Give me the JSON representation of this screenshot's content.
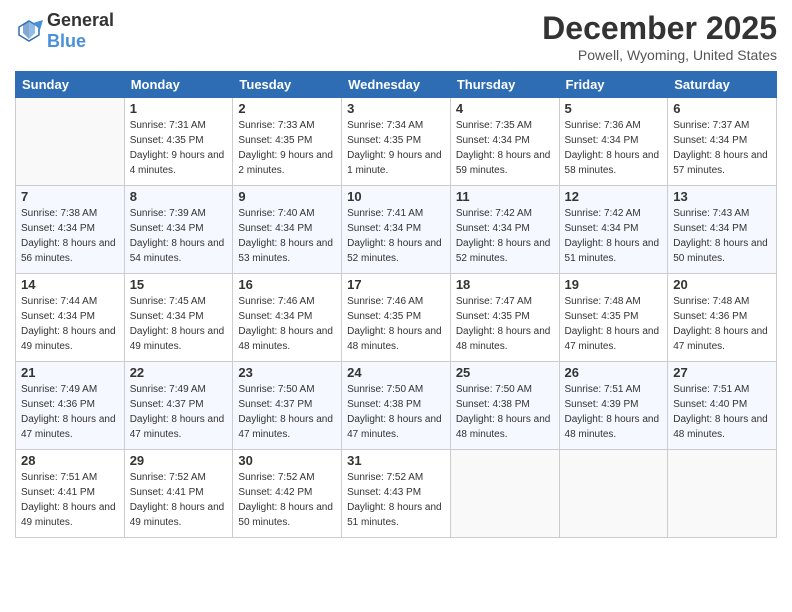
{
  "logo": {
    "text_general": "General",
    "text_blue": "Blue"
  },
  "header": {
    "month": "December 2025",
    "location": "Powell, Wyoming, United States"
  },
  "days_of_week": [
    "Sunday",
    "Monday",
    "Tuesday",
    "Wednesday",
    "Thursday",
    "Friday",
    "Saturday"
  ],
  "weeks": [
    [
      {
        "day": "",
        "sunrise": "",
        "sunset": "",
        "daylight": ""
      },
      {
        "day": "1",
        "sunrise": "Sunrise: 7:31 AM",
        "sunset": "Sunset: 4:35 PM",
        "daylight": "Daylight: 9 hours and 4 minutes."
      },
      {
        "day": "2",
        "sunrise": "Sunrise: 7:33 AM",
        "sunset": "Sunset: 4:35 PM",
        "daylight": "Daylight: 9 hours and 2 minutes."
      },
      {
        "day": "3",
        "sunrise": "Sunrise: 7:34 AM",
        "sunset": "Sunset: 4:35 PM",
        "daylight": "Daylight: 9 hours and 1 minute."
      },
      {
        "day": "4",
        "sunrise": "Sunrise: 7:35 AM",
        "sunset": "Sunset: 4:34 PM",
        "daylight": "Daylight: 8 hours and 59 minutes."
      },
      {
        "day": "5",
        "sunrise": "Sunrise: 7:36 AM",
        "sunset": "Sunset: 4:34 PM",
        "daylight": "Daylight: 8 hours and 58 minutes."
      },
      {
        "day": "6",
        "sunrise": "Sunrise: 7:37 AM",
        "sunset": "Sunset: 4:34 PM",
        "daylight": "Daylight: 8 hours and 57 minutes."
      }
    ],
    [
      {
        "day": "7",
        "sunrise": "Sunrise: 7:38 AM",
        "sunset": "Sunset: 4:34 PM",
        "daylight": "Daylight: 8 hours and 56 minutes."
      },
      {
        "day": "8",
        "sunrise": "Sunrise: 7:39 AM",
        "sunset": "Sunset: 4:34 PM",
        "daylight": "Daylight: 8 hours and 54 minutes."
      },
      {
        "day": "9",
        "sunrise": "Sunrise: 7:40 AM",
        "sunset": "Sunset: 4:34 PM",
        "daylight": "Daylight: 8 hours and 53 minutes."
      },
      {
        "day": "10",
        "sunrise": "Sunrise: 7:41 AM",
        "sunset": "Sunset: 4:34 PM",
        "daylight": "Daylight: 8 hours and 52 minutes."
      },
      {
        "day": "11",
        "sunrise": "Sunrise: 7:42 AM",
        "sunset": "Sunset: 4:34 PM",
        "daylight": "Daylight: 8 hours and 52 minutes."
      },
      {
        "day": "12",
        "sunrise": "Sunrise: 7:42 AM",
        "sunset": "Sunset: 4:34 PM",
        "daylight": "Daylight: 8 hours and 51 minutes."
      },
      {
        "day": "13",
        "sunrise": "Sunrise: 7:43 AM",
        "sunset": "Sunset: 4:34 PM",
        "daylight": "Daylight: 8 hours and 50 minutes."
      }
    ],
    [
      {
        "day": "14",
        "sunrise": "Sunrise: 7:44 AM",
        "sunset": "Sunset: 4:34 PM",
        "daylight": "Daylight: 8 hours and 49 minutes."
      },
      {
        "day": "15",
        "sunrise": "Sunrise: 7:45 AM",
        "sunset": "Sunset: 4:34 PM",
        "daylight": "Daylight: 8 hours and 49 minutes."
      },
      {
        "day": "16",
        "sunrise": "Sunrise: 7:46 AM",
        "sunset": "Sunset: 4:34 PM",
        "daylight": "Daylight: 8 hours and 48 minutes."
      },
      {
        "day": "17",
        "sunrise": "Sunrise: 7:46 AM",
        "sunset": "Sunset: 4:35 PM",
        "daylight": "Daylight: 8 hours and 48 minutes."
      },
      {
        "day": "18",
        "sunrise": "Sunrise: 7:47 AM",
        "sunset": "Sunset: 4:35 PM",
        "daylight": "Daylight: 8 hours and 48 minutes."
      },
      {
        "day": "19",
        "sunrise": "Sunrise: 7:48 AM",
        "sunset": "Sunset: 4:35 PM",
        "daylight": "Daylight: 8 hours and 47 minutes."
      },
      {
        "day": "20",
        "sunrise": "Sunrise: 7:48 AM",
        "sunset": "Sunset: 4:36 PM",
        "daylight": "Daylight: 8 hours and 47 minutes."
      }
    ],
    [
      {
        "day": "21",
        "sunrise": "Sunrise: 7:49 AM",
        "sunset": "Sunset: 4:36 PM",
        "daylight": "Daylight: 8 hours and 47 minutes."
      },
      {
        "day": "22",
        "sunrise": "Sunrise: 7:49 AM",
        "sunset": "Sunset: 4:37 PM",
        "daylight": "Daylight: 8 hours and 47 minutes."
      },
      {
        "day": "23",
        "sunrise": "Sunrise: 7:50 AM",
        "sunset": "Sunset: 4:37 PM",
        "daylight": "Daylight: 8 hours and 47 minutes."
      },
      {
        "day": "24",
        "sunrise": "Sunrise: 7:50 AM",
        "sunset": "Sunset: 4:38 PM",
        "daylight": "Daylight: 8 hours and 47 minutes."
      },
      {
        "day": "25",
        "sunrise": "Sunrise: 7:50 AM",
        "sunset": "Sunset: 4:38 PM",
        "daylight": "Daylight: 8 hours and 48 minutes."
      },
      {
        "day": "26",
        "sunrise": "Sunrise: 7:51 AM",
        "sunset": "Sunset: 4:39 PM",
        "daylight": "Daylight: 8 hours and 48 minutes."
      },
      {
        "day": "27",
        "sunrise": "Sunrise: 7:51 AM",
        "sunset": "Sunset: 4:40 PM",
        "daylight": "Daylight: 8 hours and 48 minutes."
      }
    ],
    [
      {
        "day": "28",
        "sunrise": "Sunrise: 7:51 AM",
        "sunset": "Sunset: 4:41 PM",
        "daylight": "Daylight: 8 hours and 49 minutes."
      },
      {
        "day": "29",
        "sunrise": "Sunrise: 7:52 AM",
        "sunset": "Sunset: 4:41 PM",
        "daylight": "Daylight: 8 hours and 49 minutes."
      },
      {
        "day": "30",
        "sunrise": "Sunrise: 7:52 AM",
        "sunset": "Sunset: 4:42 PM",
        "daylight": "Daylight: 8 hours and 50 minutes."
      },
      {
        "day": "31",
        "sunrise": "Sunrise: 7:52 AM",
        "sunset": "Sunset: 4:43 PM",
        "daylight": "Daylight: 8 hours and 51 minutes."
      },
      {
        "day": "",
        "sunrise": "",
        "sunset": "",
        "daylight": ""
      },
      {
        "day": "",
        "sunrise": "",
        "sunset": "",
        "daylight": ""
      },
      {
        "day": "",
        "sunrise": "",
        "sunset": "",
        "daylight": ""
      }
    ]
  ]
}
